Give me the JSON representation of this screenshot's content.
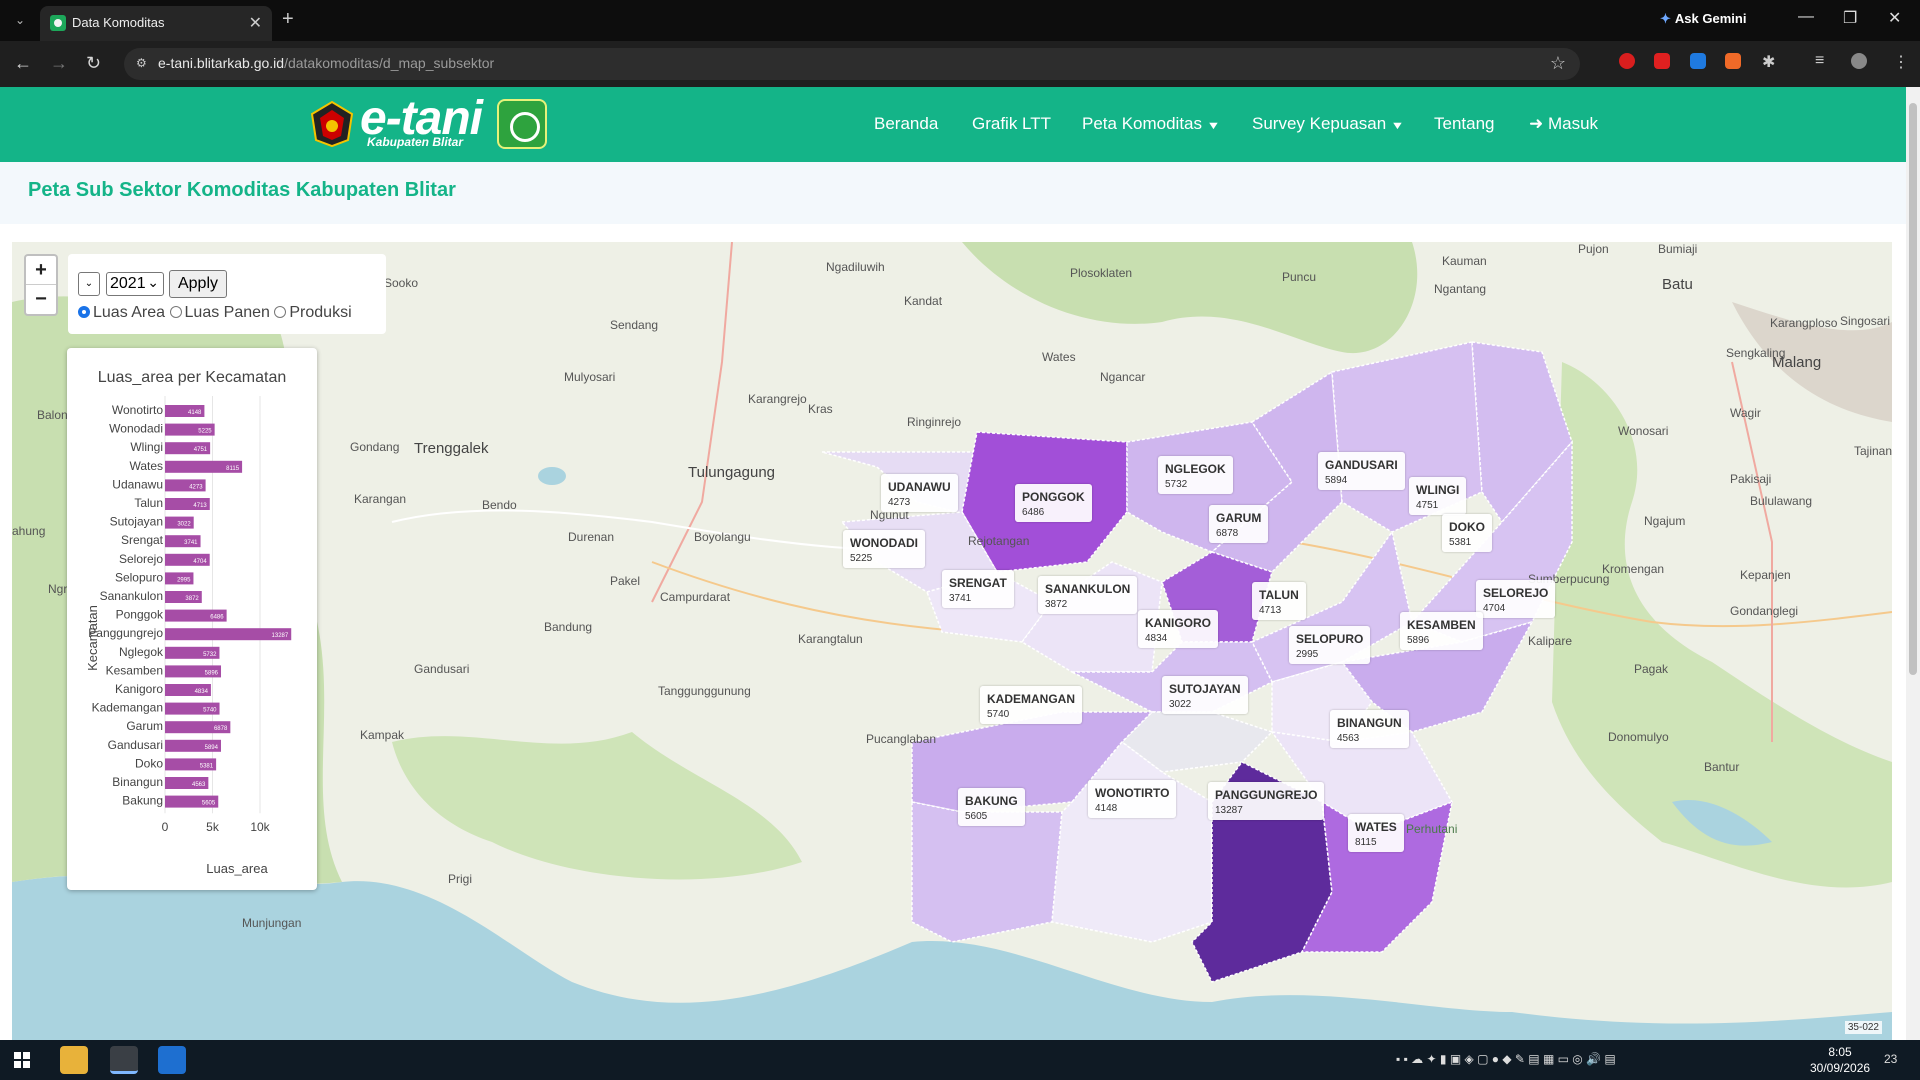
{
  "browser": {
    "tab_title": "Data Komoditas",
    "url_domain": "e-tani.blitarkab.go.id",
    "url_path": "/datakomoditas/d_map_subsektor",
    "gemini_label": "Ask Gemini"
  },
  "header": {
    "logo_text": "e-tani",
    "logo_sub": "Kabupaten Blitar",
    "nav": [
      {
        "label": "Beranda"
      },
      {
        "label": "Grafik LTT"
      },
      {
        "label": "Peta Komoditas",
        "dropdown": true
      },
      {
        "label": "Survey Kepuasan",
        "dropdown": true
      },
      {
        "label": "Tentang"
      },
      {
        "label": "Masuk",
        "icon": "login-icon"
      }
    ]
  },
  "page": {
    "title": "Peta Sub Sektor Komoditas Kabupaten Blitar"
  },
  "map_controls": {
    "zoom_in": "+",
    "zoom_out": "−",
    "year": "2021",
    "apply_label": "Apply",
    "radios": [
      {
        "label": "Luas Area",
        "checked": true
      },
      {
        "label": "Luas Panen",
        "checked": false
      },
      {
        "label": "Produksi",
        "checked": false
      }
    ],
    "attribution": "35-022"
  },
  "chart_data": {
    "type": "bar",
    "orientation": "horizontal",
    "title": "Luas_area per Kecamatan",
    "xlabel": "Luas_area",
    "ylabel": "Kecamatan",
    "xlim": [
      0,
      10000
    ],
    "xticks": [
      "0",
      "5k",
      "10k"
    ],
    "categories": [
      "Wonotirto",
      "Wonodadi",
      "Wlingi",
      "Wates",
      "Udanawu",
      "Talun",
      "Sutojayan",
      "Srengat",
      "Selorejo",
      "Selopuro",
      "Sanankulon",
      "Ponggok",
      "Panggungrejo",
      "Nglegok",
      "Kesamben",
      "Kanigoro",
      "Kademangan",
      "Garum",
      "Gandusari",
      "Doko",
      "Binangun",
      "Bakung"
    ],
    "values": [
      4148,
      5225,
      4751,
      8115,
      4273,
      4713,
      3022,
      3741,
      4704,
      2995,
      3872,
      6486,
      13287,
      5732,
      5896,
      4834,
      5740,
      6878,
      5894,
      5381,
      4563,
      5605
    ],
    "bar_color": "#a64da6"
  },
  "districts": [
    {
      "name": "UDANAWU",
      "value": "4273"
    },
    {
      "name": "PONGGOK",
      "value": "6486"
    },
    {
      "name": "NGLEGOK",
      "value": "5732"
    },
    {
      "name": "GANDUSARI",
      "value": "5894"
    },
    {
      "name": "WLINGI",
      "value": "4751"
    },
    {
      "name": "GARUM",
      "value": "6878"
    },
    {
      "name": "DOKO",
      "value": "5381"
    },
    {
      "name": "WONODADI",
      "value": "5225"
    },
    {
      "name": "SRENGAT",
      "value": "3741"
    },
    {
      "name": "SANANKULON",
      "value": "3872"
    },
    {
      "name": "TALUN",
      "value": "4713"
    },
    {
      "name": "SELOREJO",
      "value": "4704"
    },
    {
      "name": "KANIGORO",
      "value": "4834"
    },
    {
      "name": "KESAMBEN",
      "value": "5896"
    },
    {
      "name": "SELOPURO",
      "value": "2995"
    },
    {
      "name": "SUTOJAYAN",
      "value": "3022"
    },
    {
      "name": "KADEMANGAN",
      "value": "5740"
    },
    {
      "name": "BINANGUN",
      "value": "4563"
    },
    {
      "name": "BAKUNG",
      "value": "5605"
    },
    {
      "name": "WONOTIRTO",
      "value": "4148"
    },
    {
      "name": "PANGGUNGREJO",
      "value": "13287"
    },
    {
      "name": "WATES",
      "value": "8115"
    }
  ],
  "places": [
    {
      "name": "Trenggalek",
      "big": true
    },
    {
      "name": "Tulungagung",
      "big": true
    },
    {
      "name": "Malang",
      "big": true
    },
    {
      "name": "Batu",
      "big": true
    },
    {
      "name": "Sendang"
    },
    {
      "name": "Kandat"
    },
    {
      "name": "Ngadiluwih"
    },
    {
      "name": "Plosoklaten"
    },
    {
      "name": "Puncu"
    },
    {
      "name": "Kauman"
    },
    {
      "name": "Ngantang"
    },
    {
      "name": "Pujon"
    },
    {
      "name": "Bumiaji"
    },
    {
      "name": "Singosari"
    },
    {
      "name": "Karangploso"
    },
    {
      "name": "Sengkaling"
    },
    {
      "name": "Wagir"
    },
    {
      "name": "Wonosari"
    },
    {
      "name": "Pakisaji"
    },
    {
      "name": "Tajinan"
    },
    {
      "name": "Bululawang"
    },
    {
      "name": "Ngajum"
    },
    {
      "name": "Kromengan"
    },
    {
      "name": "Kepanjen"
    },
    {
      "name": "Sumberpucung"
    },
    {
      "name": "Kalipare"
    },
    {
      "name": "Gondanglegi"
    },
    {
      "name": "Pagak"
    },
    {
      "name": "Donomulyo"
    },
    {
      "name": "Bantur"
    },
    {
      "name": "Perhutani"
    },
    {
      "name": "Sooko"
    },
    {
      "name": "Mulyosari"
    },
    {
      "name": "Karangrejo"
    },
    {
      "name": "Gondang"
    },
    {
      "name": "Karangan"
    },
    {
      "name": "Bendo"
    },
    {
      "name": "Durenan"
    },
    {
      "name": "Boyolangu"
    },
    {
      "name": "Ngunut"
    },
    {
      "name": "Rejotangan"
    },
    {
      "name": "Pakel"
    },
    {
      "name": "Campurdarat"
    },
    {
      "name": "Bandung"
    },
    {
      "name": "Karangtalun"
    },
    {
      "name": "Tanggunggunung"
    },
    {
      "name": "Pucanglaban"
    },
    {
      "name": "Gandusari"
    },
    {
      "name": "Kampak"
    },
    {
      "name": "Prigi"
    },
    {
      "name": "Munjungan"
    },
    {
      "name": "Ngancar"
    },
    {
      "name": "Wates"
    },
    {
      "name": "Kras"
    },
    {
      "name": "Ringinrejo"
    },
    {
      "name": "Balon"
    },
    {
      "name": "Ngr"
    },
    {
      "name": "ahung"
    }
  ],
  "taskbar": {
    "time": "8:05",
    "date": "30/09/2026",
    "notif": "23"
  }
}
